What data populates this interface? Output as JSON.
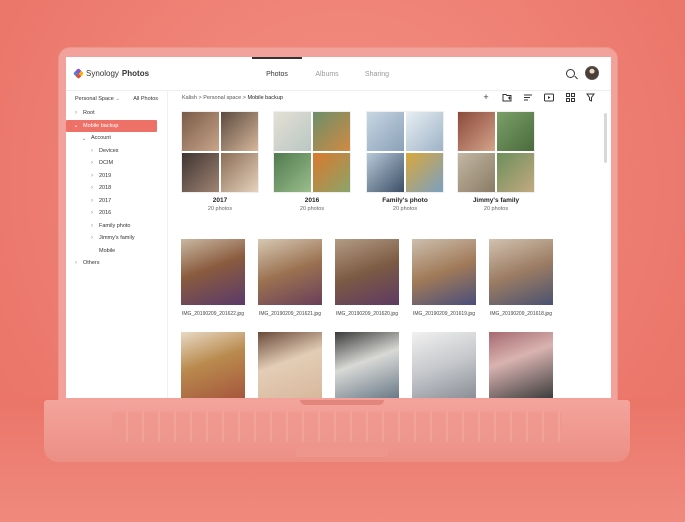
{
  "app": {
    "logo_brand": "Synology",
    "logo_product": "Photos"
  },
  "tabs": [
    {
      "label": "Photos",
      "active": true
    },
    {
      "label": "Albums",
      "active": false
    },
    {
      "label": "Sharing",
      "active": false
    }
  ],
  "sidebar": {
    "space_label": "Personal Space",
    "all_photos_label": "All Photos",
    "tree": [
      {
        "label": "Root",
        "chevron": "›"
      },
      {
        "label": "Mobile backup",
        "chevron": "⌄",
        "selected": true
      },
      {
        "label": "Account",
        "chevron": "⌄"
      },
      {
        "label": "Devices",
        "chevron": "›"
      },
      {
        "label": "DCIM",
        "chevron": "›"
      },
      {
        "label": "2019",
        "chevron": "›"
      },
      {
        "label": "2018",
        "chevron": "›"
      },
      {
        "label": "2017",
        "chevron": "›"
      },
      {
        "label": "2016",
        "chevron": "›"
      },
      {
        "label": "Family photo",
        "chevron": "›"
      },
      {
        "label": "Jimmy's family",
        "chevron": "›"
      },
      {
        "label": "Mobile",
        "chevron": ""
      },
      {
        "label": "Others",
        "chevron": "›"
      }
    ]
  },
  "breadcrumb": {
    "path": "Kalish > Personal space > ",
    "current": "Mobile backup"
  },
  "toolbar_icons": [
    "plus-icon",
    "folder-add-icon",
    "sort-icon",
    "slideshow-icon",
    "grid-view-icon",
    "filter-icon"
  ],
  "albums": [
    {
      "name": "2017",
      "count": "20 photos"
    },
    {
      "name": "2016",
      "count": "20 photos"
    },
    {
      "name": "Family's photo",
      "count": "20 photos"
    },
    {
      "name": "Jimmy's family",
      "count": "20 photos"
    }
  ],
  "photos": [
    {
      "filename": "IMG_20190209_201622.jpg"
    },
    {
      "filename": "IMG_20190209_201621.jpg"
    },
    {
      "filename": "IMG_20190209_201620.jpg"
    },
    {
      "filename": "IMG_20190209_201619.jpg"
    },
    {
      "filename": "IMG_20190209_201618.jpg"
    }
  ],
  "colors": {
    "accent": "#ee7168",
    "background": "#ee7e72"
  }
}
